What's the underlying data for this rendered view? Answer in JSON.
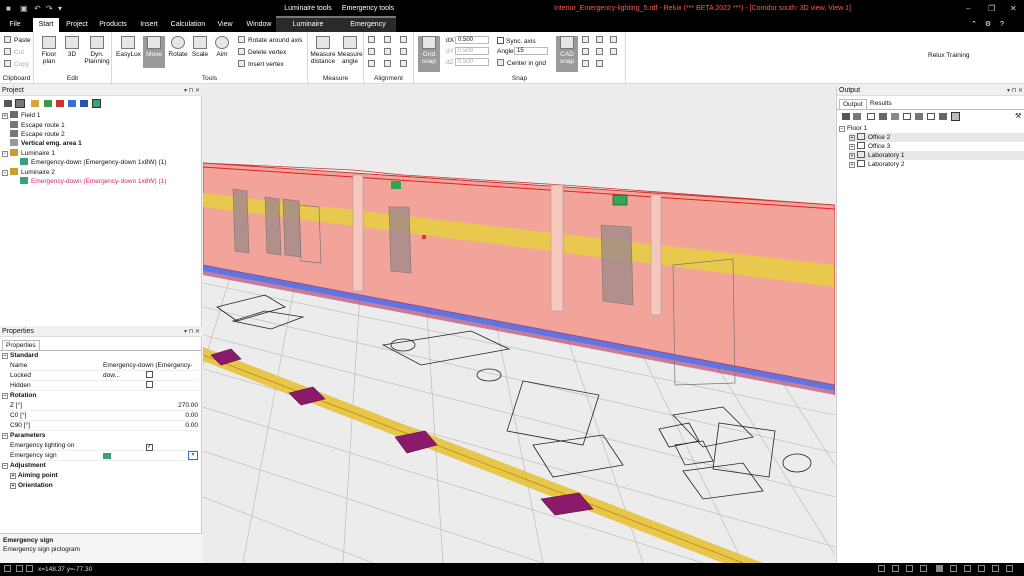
{
  "window": {
    "title": "Interior_Emergency-lighting_5.rdf - Relux (*** BETA 2022 ***) - [Corridor south: 3D view, View 1]"
  },
  "context_tabs": {
    "luminaire_tools": "Luminaire tools",
    "emergency_tools": "Emergency tools"
  },
  "ribbon_tabs": [
    "File",
    "Start",
    "Project",
    "Products",
    "Insert",
    "Calculation",
    "View",
    "Window",
    "Luminaire",
    "Emergency"
  ],
  "user": "Relux Training",
  "clipboard": {
    "paste": "Paste",
    "cut": "Cut",
    "copy": "Copy",
    "label": "Clipboard"
  },
  "edit": {
    "floor_plan": "Floor plan",
    "3d": "3D",
    "dyn_planning": "Dyn. Planning",
    "label": "Edit"
  },
  "tools": {
    "easylux": "EasyLux",
    "move": "Move",
    "rotate": "Rotate",
    "scale": "Scale",
    "aim": "Aim",
    "rotate_around_axis": "Rotate around axis",
    "delete_vertex": "Delete vertex",
    "insert_vertex": "Insert vertex",
    "label": "Tools"
  },
  "measure": {
    "distance": "Measure distance",
    "angle": "Measure angle",
    "label": "Measure"
  },
  "alignment": {
    "label": "Alignment"
  },
  "snap": {
    "grid_snap": "Grid snap",
    "dx_label": "dX",
    "dx": "0.500",
    "dy_label": "dY",
    "dy": "0.500",
    "dz_label": "dZ",
    "dz": "0.500",
    "sync_axis": "Sync. axis",
    "angle_label": "Angle",
    "angle": "15",
    "center_in_grid": "Center in grid",
    "cad_snap": "CAD snap",
    "label": "Snap"
  },
  "project_panel": {
    "title": "Project",
    "items": [
      {
        "label": "Field 1"
      },
      {
        "label": "Escape route 1"
      },
      {
        "label": "Escape route 2"
      },
      {
        "label": "Vertical emg. area 1"
      },
      {
        "label": "Luminaire 1"
      },
      {
        "label": "Emergency-down (Emergency-down 1x8W) (1)"
      },
      {
        "label": "Luminaire 2"
      },
      {
        "label": "Emergency-down (Emergency-down 1x8W) (1)"
      }
    ]
  },
  "properties_panel": {
    "title": "Properties",
    "tab": "Properties",
    "standard": "Standard",
    "name_label": "Name",
    "name_value": "Emergency-down (Emergency-dow...",
    "locked_label": "Locked",
    "hidden_label": "Hidden",
    "rotation": "Rotation",
    "z_label": "Z [°]",
    "z_value": "270.00",
    "c0_label": "C0 [°]",
    "c0_value": "0.00",
    "c90_label": "C90 [°]",
    "c90_value": "0.00",
    "parameters": "Parameters",
    "emergency_on_label": "Emergency lighting on",
    "emergency_sign_label": "Emergency sign",
    "adjustment": "Adjustment",
    "aiming_point": "Aiming point",
    "orientation": "Orientation",
    "desc_title": "Emergency sign",
    "desc_text": "Emergency sign pictogram"
  },
  "output_panel": {
    "title": "Output",
    "tabs": [
      "Output",
      "Results"
    ],
    "items": [
      {
        "label": "Floor 1"
      },
      {
        "label": "Office 2"
      },
      {
        "label": "Office 3"
      },
      {
        "label": "Laboratory 1"
      },
      {
        "label": "Laboratory 2"
      }
    ]
  },
  "status": {
    "coords": "x=148.37 y=-77.30"
  },
  "colors": {
    "accent": "#d4266c",
    "title_red": "#ff5a4e",
    "wall": "#f2a49a",
    "escape": "#e6d040",
    "marker": "#8b1a6b"
  }
}
